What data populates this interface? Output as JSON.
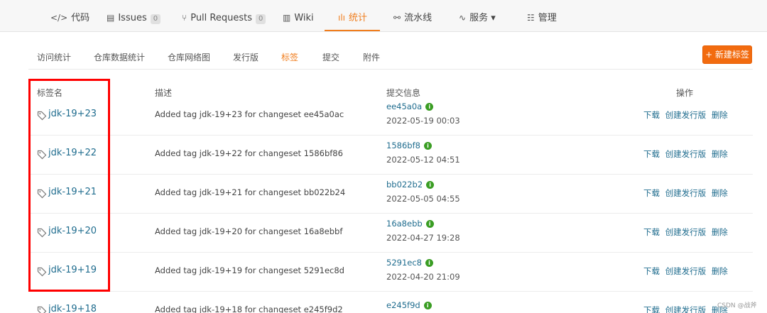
{
  "top_tabs": [
    {
      "icon": "</>",
      "label": "代码",
      "badge": ""
    },
    {
      "icon": "▤",
      "label": "Issues",
      "badge": "0"
    },
    {
      "icon": "⑂",
      "label": "Pull Requests",
      "badge": "0"
    },
    {
      "icon": "▥",
      "label": "Wiki",
      "badge": ""
    },
    {
      "icon": "ılı",
      "label": "统计",
      "badge": ""
    },
    {
      "icon": "⚯",
      "label": "流水线",
      "badge": ""
    },
    {
      "icon": "∿",
      "label": "服务 ▾",
      "badge": ""
    },
    {
      "icon": "☷",
      "label": "管理",
      "badge": ""
    }
  ],
  "active_tab": "统计",
  "sub_tabs": [
    "访问统计",
    "仓库数据统计",
    "仓库网络图",
    "发行版",
    "标签",
    "提交",
    "附件"
  ],
  "active_sub_tab": "标签",
  "new_tag_button": "+ 新建标签",
  "table": {
    "headers": {
      "name": "标签名",
      "description": "描述",
      "commit": "提交信息",
      "actions": "操作"
    },
    "rows": [
      {
        "name": "jdk-19+23",
        "description": "Added tag jdk-19+23 for changeset ee45a0ac",
        "hash": "ee45a0a",
        "date": "2022-05-19 00:03"
      },
      {
        "name": "jdk-19+22",
        "description": "Added tag jdk-19+22 for changeset 1586bf86",
        "hash": "1586bf8",
        "date": "2022-05-12 04:51"
      },
      {
        "name": "jdk-19+21",
        "description": "Added tag jdk-19+21 for changeset bb022b24",
        "hash": "bb022b2",
        "date": "2022-05-05 04:55"
      },
      {
        "name": "jdk-19+20",
        "description": "Added tag jdk-19+20 for changeset 16a8ebbf",
        "hash": "16a8ebb",
        "date": "2022-04-27 19:28"
      },
      {
        "name": "jdk-19+19",
        "description": "Added tag jdk-19+19 for changeset 5291ec8d",
        "hash": "5291ec8",
        "date": "2022-04-20 21:09"
      },
      {
        "name": "jdk-19+18",
        "description": "Added tag jdk-19+18 for changeset e245f9d2",
        "hash": "e245f9d",
        "date": ""
      }
    ],
    "action_labels": {
      "download": "下载",
      "create_release": "创建发行版",
      "delete": "删除"
    }
  },
  "watermark": "CSDN @战斧",
  "colors": {
    "accent": "#f07d1d",
    "link": "#1f6c8e",
    "verified": "#3a9d23",
    "highlight_box": "#ff0000"
  }
}
